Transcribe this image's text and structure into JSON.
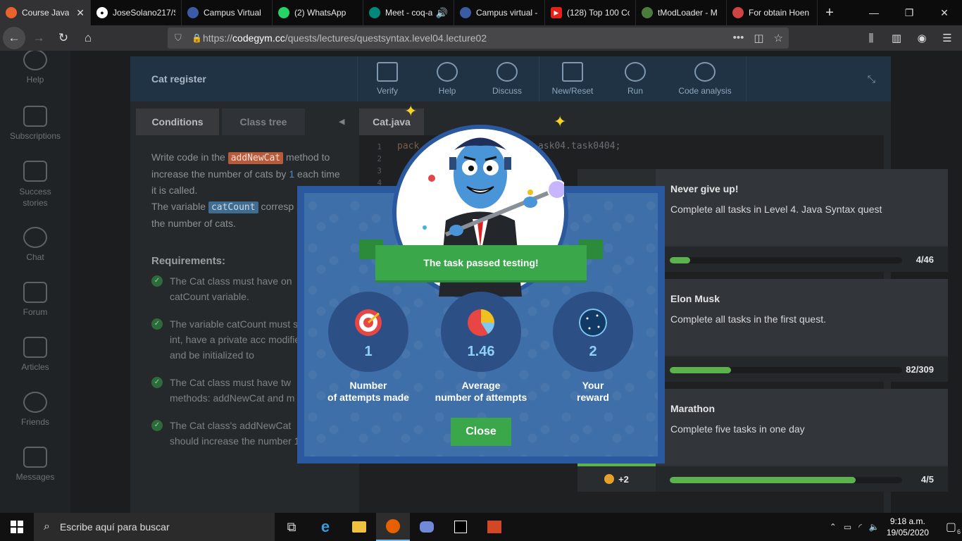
{
  "browser": {
    "tabs": [
      {
        "label": "Course Java",
        "color": "#e8632e",
        "active": true
      },
      {
        "label": "JoseSolano217/S",
        "color": "#24292e",
        "active": false
      },
      {
        "label": "Campus Virtual",
        "color": "#3b5ba5",
        "active": false
      },
      {
        "label": "(2) WhatsApp",
        "color": "#25d366",
        "active": false
      },
      {
        "label": "Meet - coq-a",
        "color": "#00897b",
        "active": false
      },
      {
        "label": "Campus virtual -",
        "color": "#3b5ba5",
        "active": false
      },
      {
        "label": "(128) Top 100 Co",
        "color": "#e62117",
        "active": false
      },
      {
        "label": "tModLoader - M",
        "color": "#4a7c3e",
        "active": false
      },
      {
        "label": "For obtain Hoen",
        "color": "#c44",
        "active": false
      }
    ],
    "url_prefix": "https://",
    "url_domain": "codegym.cc",
    "url_path": "/quests/lectures/questsyntax.level04.lecture02"
  },
  "leftnav": [
    {
      "label": "Help"
    },
    {
      "label": "Subscriptions"
    },
    {
      "label": "Success stories"
    },
    {
      "label": "Chat"
    },
    {
      "label": "Forum"
    },
    {
      "label": "Articles"
    },
    {
      "label": "Friends"
    },
    {
      "label": "Messages"
    }
  ],
  "panel": {
    "title": "Cat register",
    "tools": [
      "Verify",
      "Help",
      "Discuss",
      "New/Reset",
      "Run",
      "Code analysis"
    ],
    "tabs": [
      "Conditions",
      "Class tree"
    ],
    "editor_tab": "Cat.java",
    "code_prefix": "pack",
    "code_suffix": "ask04.task0404;",
    "line_numbers": [
      "1",
      "2",
      "3",
      "4"
    ]
  },
  "conditions": {
    "p1_a": "Write code in the ",
    "p1_code": "addNewCat",
    "p1_b": " method to increase the number of cats by ",
    "p1_num": "1",
    "p1_c": " each time it is called.",
    "p2_a": "The variable ",
    "p2_code": "catCount",
    "p2_b": " corresp",
    "p2_c": "the number of cats.",
    "req_title": "Requirements:",
    "requirements": [
      "The Cat class must have on catCount variable.",
      "The variable catCount must static int, have a private acc modifier, and be initialized to",
      "The Cat class must have tw methods: addNewCat and m",
      "The Cat class's addNewCat should increase the number 1."
    ]
  },
  "achievements": [
    {
      "name": "Never give up!",
      "desc": "Complete all tasks in Level 4. Java Syntax quest",
      "progress": "4/46",
      "fill": 0.087
    },
    {
      "name": "Elon Musk",
      "desc": "Complete all tasks in the first quest.",
      "progress": "82/309",
      "fill": 0.265
    },
    {
      "name": "Marathon",
      "desc": "Complete five tasks in one day",
      "progress": "4/5",
      "fill": 0.8,
      "reward": "+2"
    }
  ],
  "modal": {
    "banner": "The task passed testing!",
    "stats": [
      {
        "value": "1",
        "label_1": "Number",
        "label_2": "of attempts made"
      },
      {
        "value": "1.46",
        "label_1": "Average",
        "label_2": "number of attempts"
      },
      {
        "value": "2",
        "label_1": "Your",
        "label_2": "reward"
      }
    ],
    "close_label": "Close"
  },
  "taskbar": {
    "search_placeholder": "Escribe aquí para buscar",
    "time": "9:18 a.m.",
    "date": "19/05/2020",
    "notifications": "6"
  }
}
